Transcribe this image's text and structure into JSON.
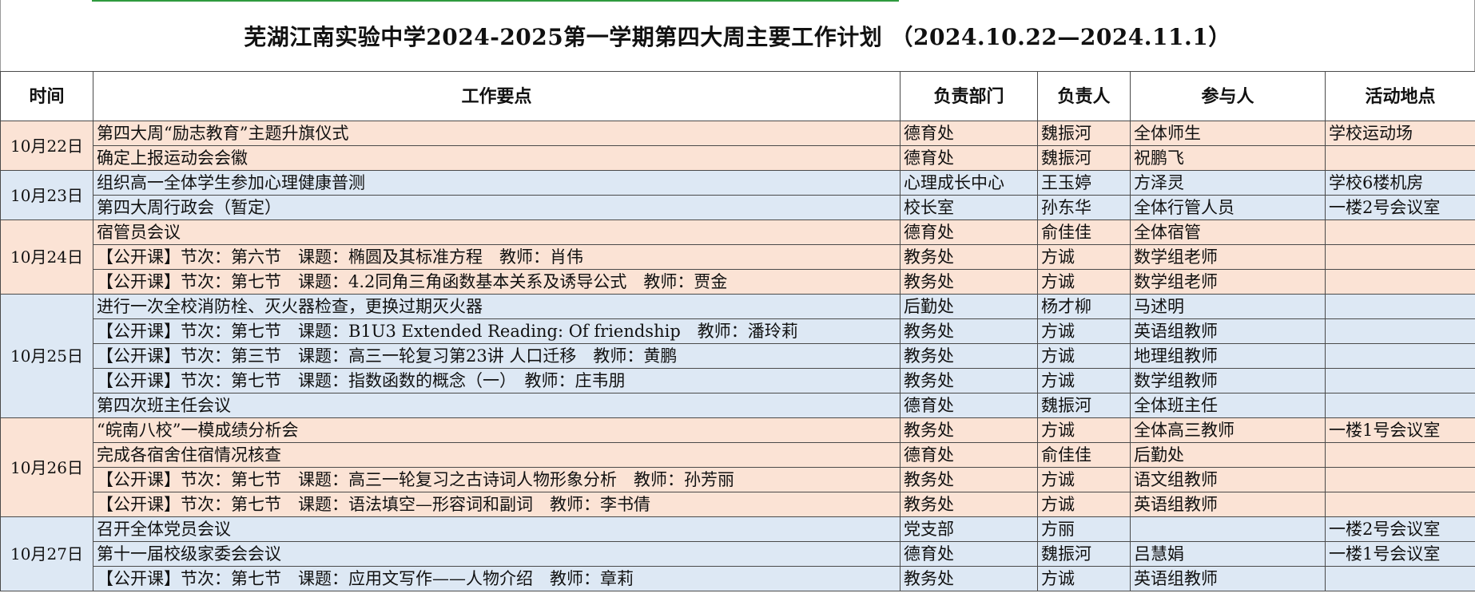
{
  "title": "芜湖江南实验中学2024-2025第一学期第四大周主要工作计划 （2024.10.22—2024.11.1）",
  "headers": {
    "time": "时间",
    "item": "工作要点",
    "dept": "负责部门",
    "owner": "负责人",
    "participants": "参与人",
    "place": "活动地点"
  },
  "days": [
    {
      "date": "10月22日",
      "rows": [
        {
          "item": "第四大周“励志教育”主题升旗仪式",
          "dept": "德育处",
          "owner": "魏振河",
          "participants": "全体师生",
          "place": "学校运动场"
        },
        {
          "item": "确定上报运动会会徽",
          "dept": "德育处",
          "owner": "魏振河",
          "participants": "祝鹏飞",
          "place": ""
        }
      ]
    },
    {
      "date": "10月23日",
      "rows": [
        {
          "item": "组织高一全体学生参加心理健康普测",
          "dept": "心理成长中心",
          "owner": "王玉婷",
          "participants": "方泽灵",
          "place": "学校6楼机房"
        },
        {
          "item": "第四大周行政会（暂定）",
          "dept": "校长室",
          "owner": "孙东华",
          "participants": "全体行管人员",
          "place": "一楼2号会议室"
        }
      ]
    },
    {
      "date": "10月24日",
      "rows": [
        {
          "item": "宿管员会议",
          "dept": "德育处",
          "owner": "俞佳佳",
          "participants": "全体宿管",
          "place": ""
        },
        {
          "item": "【公开课】节次：第六节　课题：椭圆及其标准方程　教师：肖伟",
          "dept": "教务处",
          "owner": "方诚",
          "participants": "数学组老师",
          "place": ""
        },
        {
          "item": "【公开课】节次：第七节　课题：4.2同角三角函数基本关系及诱导公式　教师：贾金",
          "dept": "教务处",
          "owner": "方诚",
          "participants": "数学组老师",
          "place": ""
        }
      ]
    },
    {
      "date": "10月25日",
      "rows": [
        {
          "item": "进行一次全校消防栓、灭火器检查，更换过期灭火器",
          "dept": "后勤处",
          "owner": "杨才柳",
          "participants": "马述明",
          "place": ""
        },
        {
          "item": "【公开课】节次：第七节　课题：B1U3 Extended Reading: Of friendship　教师：潘玲莉",
          "dept": "教务处",
          "owner": "方诚",
          "participants": "英语组教师",
          "place": ""
        },
        {
          "item": "【公开课】节次：第三节　课题：高三一轮复习第23讲 人口迁移　教师：黄鹏",
          "dept": "教务处",
          "owner": "方诚",
          "participants": "地理组教师",
          "place": ""
        },
        {
          "item": "【公开课】节次：第七节　课题：指数函数的概念（一）　教师：庄韦朋",
          "dept": "教务处",
          "owner": "方诚",
          "participants": "数学组教师",
          "place": ""
        },
        {
          "item": "第四次班主任会议",
          "dept": "德育处",
          "owner": "魏振河",
          "participants": "全体班主任",
          "place": ""
        }
      ]
    },
    {
      "date": "10月26日",
      "rows": [
        {
          "item": "“皖南八校”一模成绩分析会",
          "dept": "教务处",
          "owner": "方诚",
          "participants": "全体高三教师",
          "place": "一楼1号会议室"
        },
        {
          "item": "完成各宿舍住宿情况核查",
          "dept": "德育处",
          "owner": "俞佳佳",
          "participants": "后勤处",
          "place": ""
        },
        {
          "item": "【公开课】节次：第七节　课题：高三一轮复习之古诗词人物形象分析　教师：孙芳丽",
          "dept": "教务处",
          "owner": "方诚",
          "participants": "语文组教师",
          "place": ""
        },
        {
          "item": "【公开课】节次：第七节　课题：语法填空—形容词和副词　教师：李书倩",
          "dept": "教务处",
          "owner": "方诚",
          "participants": "英语组教师",
          "place": ""
        }
      ]
    },
    {
      "date": "10月27日",
      "rows": [
        {
          "item": "召开全体党员会议",
          "dept": "党支部",
          "owner": "方丽",
          "participants": "",
          "place": "一楼2号会议室"
        },
        {
          "item": "第十一届校级家委会会议",
          "dept": "德育处",
          "owner": "魏振河",
          "participants": "吕慧娟",
          "place": "一楼1号会议室"
        },
        {
          "item": "【公开课】节次：第七节　课题：应用文写作——人物介绍　教师：章莉",
          "dept": "教务处",
          "owner": "方诚",
          "participants": "英语组教师",
          "place": ""
        }
      ]
    }
  ]
}
